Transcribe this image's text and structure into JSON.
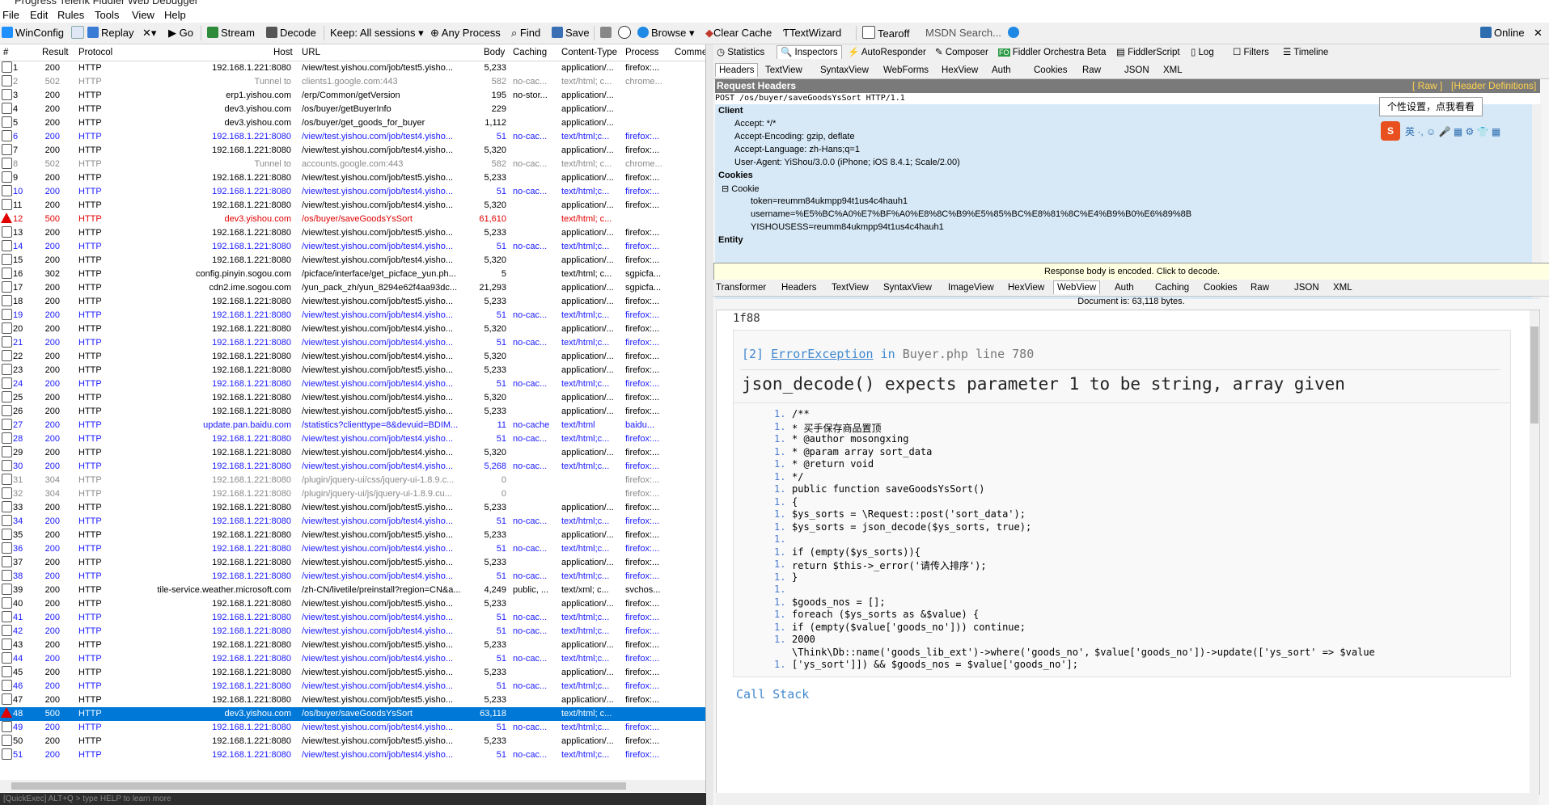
{
  "window": {
    "title": "Progress Telerik Fiddler Web Debugger"
  },
  "menu": [
    "File",
    "Edit",
    "Rules",
    "Tools",
    "View",
    "Help"
  ],
  "toolbar": {
    "winconfig": "WinConfig",
    "replay": "Replay",
    "remove": "✕▾",
    "go": "Go",
    "stream": "Stream",
    "decode": "Decode",
    "keep": "Keep: All sessions ▾",
    "process": "Any Process",
    "find": "Find",
    "save": "Save",
    "browse": "Browse ▾",
    "clear_cache": "Clear Cache",
    "textwizard": "TextWizard",
    "tearoff": "Tearoff",
    "msdn_search": "MSDN Search...",
    "online": "Online"
  },
  "session_headers": {
    "num": "#",
    "result": "Result",
    "protocol": "Protocol",
    "host": "Host",
    "url": "URL",
    "body": "Body",
    "caching": "Caching",
    "ctype": "Content-Type",
    "process": "Process",
    "comments": "Commer"
  },
  "sessions": [
    {
      "num": "1",
      "result": "200",
      "protocol": "HTTP",
      "host": "192.168.1.221:8080",
      "url": "/view/test.yishou.com/job/test5.yisho...",
      "body": "5,233",
      "caching": "",
      "ctype": "application/...",
      "process": "firefox:...",
      "style": ""
    },
    {
      "num": "2",
      "result": "502",
      "protocol": "HTTP",
      "host": "Tunnel to",
      "url": "clients1.google.com:443",
      "body": "582",
      "caching": "no-cac...",
      "ctype": "text/html; c...",
      "process": "chrome...",
      "style": "gray"
    },
    {
      "num": "3",
      "result": "200",
      "protocol": "HTTP",
      "host": "erp1.yishou.com",
      "url": "/erp/Common/getVersion",
      "body": "195",
      "caching": "no-stor...",
      "ctype": "application/...",
      "process": "",
      "style": ""
    },
    {
      "num": "4",
      "result": "200",
      "protocol": "HTTP",
      "host": "dev3.yishou.com",
      "url": "/os/buyer/getBuyerInfo",
      "body": "229",
      "caching": "",
      "ctype": "application/...",
      "process": "",
      "style": ""
    },
    {
      "num": "5",
      "result": "200",
      "protocol": "HTTP",
      "host": "dev3.yishou.com",
      "url": "/os/buyer/get_goods_for_buyer",
      "body": "1,112",
      "caching": "",
      "ctype": "application/...",
      "process": "",
      "style": ""
    },
    {
      "num": "6",
      "result": "200",
      "protocol": "HTTP",
      "host": "192.168.1.221:8080",
      "url": "/view/test.yishou.com/job/test4.yisho...",
      "body": "51",
      "caching": "no-cac...",
      "ctype": "text/html;c...",
      "process": "firefox:...",
      "style": "blue"
    },
    {
      "num": "7",
      "result": "200",
      "protocol": "HTTP",
      "host": "192.168.1.221:8080",
      "url": "/view/test.yishou.com/job/test4.yisho...",
      "body": "5,320",
      "caching": "",
      "ctype": "application/...",
      "process": "firefox:...",
      "style": ""
    },
    {
      "num": "8",
      "result": "502",
      "protocol": "HTTP",
      "host": "Tunnel to",
      "url": "accounts.google.com:443",
      "body": "582",
      "caching": "no-cac...",
      "ctype": "text/html; c...",
      "process": "chrome...",
      "style": "gray"
    },
    {
      "num": "9",
      "result": "200",
      "protocol": "HTTP",
      "host": "192.168.1.221:8080",
      "url": "/view/test.yishou.com/job/test5.yisho...",
      "body": "5,233",
      "caching": "",
      "ctype": "application/...",
      "process": "firefox:...",
      "style": ""
    },
    {
      "num": "10",
      "result": "200",
      "protocol": "HTTP",
      "host": "192.168.1.221:8080",
      "url": "/view/test.yishou.com/job/test4.yisho...",
      "body": "51",
      "caching": "no-cac...",
      "ctype": "text/html;c...",
      "process": "firefox:...",
      "style": "blue"
    },
    {
      "num": "11",
      "result": "200",
      "protocol": "HTTP",
      "host": "192.168.1.221:8080",
      "url": "/view/test.yishou.com/job/test4.yisho...",
      "body": "5,320",
      "caching": "",
      "ctype": "application/...",
      "process": "firefox:...",
      "style": ""
    },
    {
      "num": "12",
      "result": "500",
      "protocol": "HTTP",
      "host": "dev3.yishou.com",
      "url": "/os/buyer/saveGoodsYsSort",
      "body": "61,610",
      "caching": "",
      "ctype": "text/html; c...",
      "process": "",
      "style": "red"
    },
    {
      "num": "13",
      "result": "200",
      "protocol": "HTTP",
      "host": "192.168.1.221:8080",
      "url": "/view/test.yishou.com/job/test5.yisho...",
      "body": "5,233",
      "caching": "",
      "ctype": "application/...",
      "process": "firefox:...",
      "style": ""
    },
    {
      "num": "14",
      "result": "200",
      "protocol": "HTTP",
      "host": "192.168.1.221:8080",
      "url": "/view/test.yishou.com/job/test4.yisho...",
      "body": "51",
      "caching": "no-cac...",
      "ctype": "text/html;c...",
      "process": "firefox:...",
      "style": "blue"
    },
    {
      "num": "15",
      "result": "200",
      "protocol": "HTTP",
      "host": "192.168.1.221:8080",
      "url": "/view/test.yishou.com/job/test4.yisho...",
      "body": "5,320",
      "caching": "",
      "ctype": "application/...",
      "process": "firefox:...",
      "style": ""
    },
    {
      "num": "16",
      "result": "302",
      "protocol": "HTTP",
      "host": "config.pinyin.sogou.com",
      "url": "/picface/interface/get_picface_yun.ph...",
      "body": "5",
      "caching": "",
      "ctype": "text/html; c...",
      "process": "sgpicfa...",
      "style": ""
    },
    {
      "num": "17",
      "result": "200",
      "protocol": "HTTP",
      "host": "cdn2.ime.sogou.com",
      "url": "/yun_pack_zh/yun_8294e62f4aa93dc...",
      "body": "21,293",
      "caching": "",
      "ctype": "application/...",
      "process": "sgpicfa...",
      "style": ""
    },
    {
      "num": "18",
      "result": "200",
      "protocol": "HTTP",
      "host": "192.168.1.221:8080",
      "url": "/view/test.yishou.com/job/test5.yisho...",
      "body": "5,233",
      "caching": "",
      "ctype": "application/...",
      "process": "firefox:...",
      "style": ""
    },
    {
      "num": "19",
      "result": "200",
      "protocol": "HTTP",
      "host": "192.168.1.221:8080",
      "url": "/view/test.yishou.com/job/test4.yisho...",
      "body": "51",
      "caching": "no-cac...",
      "ctype": "text/html;c...",
      "process": "firefox:...",
      "style": "blue"
    },
    {
      "num": "20",
      "result": "200",
      "protocol": "HTTP",
      "host": "192.168.1.221:8080",
      "url": "/view/test.yishou.com/job/test4.yisho...",
      "body": "5,320",
      "caching": "",
      "ctype": "application/...",
      "process": "firefox:...",
      "style": ""
    },
    {
      "num": "21",
      "result": "200",
      "protocol": "HTTP",
      "host": "192.168.1.221:8080",
      "url": "/view/test.yishou.com/job/test4.yisho...",
      "body": "51",
      "caching": "no-cac...",
      "ctype": "text/html;c...",
      "process": "firefox:...",
      "style": "blue"
    },
    {
      "num": "22",
      "result": "200",
      "protocol": "HTTP",
      "host": "192.168.1.221:8080",
      "url": "/view/test.yishou.com/job/test4.yisho...",
      "body": "5,320",
      "caching": "",
      "ctype": "application/...",
      "process": "firefox:...",
      "style": ""
    },
    {
      "num": "23",
      "result": "200",
      "protocol": "HTTP",
      "host": "192.168.1.221:8080",
      "url": "/view/test.yishou.com/job/test5.yisho...",
      "body": "5,233",
      "caching": "",
      "ctype": "application/...",
      "process": "firefox:...",
      "style": ""
    },
    {
      "num": "24",
      "result": "200",
      "protocol": "HTTP",
      "host": "192.168.1.221:8080",
      "url": "/view/test.yishou.com/job/test4.yisho...",
      "body": "51",
      "caching": "no-cac...",
      "ctype": "text/html;c...",
      "process": "firefox:...",
      "style": "blue"
    },
    {
      "num": "25",
      "result": "200",
      "protocol": "HTTP",
      "host": "192.168.1.221:8080",
      "url": "/view/test.yishou.com/job/test4.yisho...",
      "body": "5,320",
      "caching": "",
      "ctype": "application/...",
      "process": "firefox:...",
      "style": ""
    },
    {
      "num": "26",
      "result": "200",
      "protocol": "HTTP",
      "host": "192.168.1.221:8080",
      "url": "/view/test.yishou.com/job/test5.yisho...",
      "body": "5,233",
      "caching": "",
      "ctype": "application/...",
      "process": "firefox:...",
      "style": ""
    },
    {
      "num": "27",
      "result": "200",
      "protocol": "HTTP",
      "host": "update.pan.baidu.com",
      "url": "/statistics?clienttype=8&devuid=BDIM...",
      "body": "11",
      "caching": "no-cache",
      "ctype": "text/html",
      "process": "baidu...",
      "style": "blue"
    },
    {
      "num": "28",
      "result": "200",
      "protocol": "HTTP",
      "host": "192.168.1.221:8080",
      "url": "/view/test.yishou.com/job/test4.yisho...",
      "body": "51",
      "caching": "no-cac...",
      "ctype": "text/html;c...",
      "process": "firefox:...",
      "style": "blue"
    },
    {
      "num": "29",
      "result": "200",
      "protocol": "HTTP",
      "host": "192.168.1.221:8080",
      "url": "/view/test.yishou.com/job/test4.yisho...",
      "body": "5,320",
      "caching": "",
      "ctype": "application/...",
      "process": "firefox:...",
      "style": ""
    },
    {
      "num": "30",
      "result": "200",
      "protocol": "HTTP",
      "host": "192.168.1.221:8080",
      "url": "/view/test.yishou.com/job/test4.yisho...",
      "body": "5,268",
      "caching": "no-cac...",
      "ctype": "text/html;c...",
      "process": "firefox:...",
      "style": "blue"
    },
    {
      "num": "31",
      "result": "304",
      "protocol": "HTTP",
      "host": "192.168.1.221:8080",
      "url": "/plugin/jquery-ui/css/jquery-ui-1.8.9.c...",
      "body": "0",
      "caching": "",
      "ctype": "",
      "process": "firefox:...",
      "style": "gray"
    },
    {
      "num": "32",
      "result": "304",
      "protocol": "HTTP",
      "host": "192.168.1.221:8080",
      "url": "/plugin/jquery-ui/js/jquery-ui-1.8.9.cu...",
      "body": "0",
      "caching": "",
      "ctype": "",
      "process": "firefox:...",
      "style": "gray"
    },
    {
      "num": "33",
      "result": "200",
      "protocol": "HTTP",
      "host": "192.168.1.221:8080",
      "url": "/view/test.yishou.com/job/test5.yisho...",
      "body": "5,233",
      "caching": "",
      "ctype": "application/...",
      "process": "firefox:...",
      "style": ""
    },
    {
      "num": "34",
      "result": "200",
      "protocol": "HTTP",
      "host": "192.168.1.221:8080",
      "url": "/view/test.yishou.com/job/test4.yisho...",
      "body": "51",
      "caching": "no-cac...",
      "ctype": "text/html;c...",
      "process": "firefox:...",
      "style": "blue"
    },
    {
      "num": "35",
      "result": "200",
      "protocol": "HTTP",
      "host": "192.168.1.221:8080",
      "url": "/view/test.yishou.com/job/test5.yisho...",
      "body": "5,233",
      "caching": "",
      "ctype": "application/...",
      "process": "firefox:...",
      "style": ""
    },
    {
      "num": "36",
      "result": "200",
      "protocol": "HTTP",
      "host": "192.168.1.221:8080",
      "url": "/view/test.yishou.com/job/test4.yisho...",
      "body": "51",
      "caching": "no-cac...",
      "ctype": "text/html;c...",
      "process": "firefox:...",
      "style": "blue"
    },
    {
      "num": "37",
      "result": "200",
      "protocol": "HTTP",
      "host": "192.168.1.221:8080",
      "url": "/view/test.yishou.com/job/test5.yisho...",
      "body": "5,233",
      "caching": "",
      "ctype": "application/...",
      "process": "firefox:...",
      "style": ""
    },
    {
      "num": "38",
      "result": "200",
      "protocol": "HTTP",
      "host": "192.168.1.221:8080",
      "url": "/view/test.yishou.com/job/test4.yisho...",
      "body": "51",
      "caching": "no-cac...",
      "ctype": "text/html;c...",
      "process": "firefox:...",
      "style": "blue"
    },
    {
      "num": "39",
      "result": "200",
      "protocol": "HTTP",
      "host": "tile-service.weather.microsoft.com",
      "url": "/zh-CN/livetile/preinstall?region=CN&a...",
      "body": "4,249",
      "caching": "public, ...",
      "ctype": "text/xml; c...",
      "process": "svchos...",
      "style": ""
    },
    {
      "num": "40",
      "result": "200",
      "protocol": "HTTP",
      "host": "192.168.1.221:8080",
      "url": "/view/test.yishou.com/job/test5.yisho...",
      "body": "5,233",
      "caching": "",
      "ctype": "application/...",
      "process": "firefox:...",
      "style": ""
    },
    {
      "num": "41",
      "result": "200",
      "protocol": "HTTP",
      "host": "192.168.1.221:8080",
      "url": "/view/test.yishou.com/job/test4.yisho...",
      "body": "51",
      "caching": "no-cac...",
      "ctype": "text/html;c...",
      "process": "firefox:...",
      "style": "blue"
    },
    {
      "num": "42",
      "result": "200",
      "protocol": "HTTP",
      "host": "192.168.1.221:8080",
      "url": "/view/test.yishou.com/job/test4.yisho...",
      "body": "51",
      "caching": "no-cac...",
      "ctype": "text/html;c...",
      "process": "firefox:...",
      "style": "blue"
    },
    {
      "num": "43",
      "result": "200",
      "protocol": "HTTP",
      "host": "192.168.1.221:8080",
      "url": "/view/test.yishou.com/job/test5.yisho...",
      "body": "5,233",
      "caching": "",
      "ctype": "application/...",
      "process": "firefox:...",
      "style": ""
    },
    {
      "num": "44",
      "result": "200",
      "protocol": "HTTP",
      "host": "192.168.1.221:8080",
      "url": "/view/test.yishou.com/job/test4.yisho...",
      "body": "51",
      "caching": "no-cac...",
      "ctype": "text/html;c...",
      "process": "firefox:...",
      "style": "blue"
    },
    {
      "num": "45",
      "result": "200",
      "protocol": "HTTP",
      "host": "192.168.1.221:8080",
      "url": "/view/test.yishou.com/job/test5.yisho...",
      "body": "5,233",
      "caching": "",
      "ctype": "application/...",
      "process": "firefox:...",
      "style": ""
    },
    {
      "num": "46",
      "result": "200",
      "protocol": "HTTP",
      "host": "192.168.1.221:8080",
      "url": "/view/test.yishou.com/job/test4.yisho...",
      "body": "51",
      "caching": "no-cac...",
      "ctype": "text/html;c...",
      "process": "firefox:...",
      "style": "blue"
    },
    {
      "num": "47",
      "result": "200",
      "protocol": "HTTP",
      "host": "192.168.1.221:8080",
      "url": "/view/test.yishou.com/job/test5.yisho...",
      "body": "5,233",
      "caching": "",
      "ctype": "application/...",
      "process": "firefox:...",
      "style": ""
    },
    {
      "num": "48",
      "result": "500",
      "protocol": "HTTP",
      "host": "dev3.yishou.com",
      "url": "/os/buyer/saveGoodsYsSort",
      "body": "63,118",
      "caching": "",
      "ctype": "text/html; c...",
      "process": "",
      "style": "sel"
    },
    {
      "num": "49",
      "result": "200",
      "protocol": "HTTP",
      "host": "192.168.1.221:8080",
      "url": "/view/test.yishou.com/job/test4.yisho...",
      "body": "51",
      "caching": "no-cac...",
      "ctype": "text/html;c...",
      "process": "firefox:...",
      "style": "blue"
    },
    {
      "num": "50",
      "result": "200",
      "protocol": "HTTP",
      "host": "192.168.1.221:8080",
      "url": "/view/test.yishou.com/job/test5.yisho...",
      "body": "5,233",
      "caching": "",
      "ctype": "application/...",
      "process": "firefox:...",
      "style": ""
    },
    {
      "num": "51",
      "result": "200",
      "protocol": "HTTP",
      "host": "192.168.1.221:8080",
      "url": "/view/test.yishou.com/job/test4.yisho...",
      "body": "51",
      "caching": "no-cac...",
      "ctype": "text/html;c...",
      "process": "firefox:...",
      "style": "blue"
    }
  ],
  "statusbar": "[QuickExec] ALT+Q > type HELP to learn more",
  "top_tabs": [
    "Statistics",
    "Inspectors",
    "AutoResponder",
    "Composer",
    "Fiddler Orchestra Beta",
    "FiddlerScript",
    "Log",
    "Filters",
    "Timeline"
  ],
  "req_tabs": [
    "Headers",
    "TextView",
    "SyntaxView",
    "WebForms",
    "HexView",
    "Auth",
    "Cookies",
    "Raw",
    "JSON",
    "XML"
  ],
  "request": {
    "title": "Request Headers",
    "raw_link": "[ Raw ]",
    "defs_link": "[Header Definitions]",
    "line": "POST /os/buyer/saveGoodsYsSort HTTP/1.1",
    "client": "Client",
    "accept": "Accept: */*",
    "encoding": "Accept-Encoding: gzip, deflate",
    "language": "Accept-Language: zh-Hans;q=1",
    "ua": "User-Agent: YiShou/3.0.0 (iPhone; iOS 8.4.1; Scale/2.00)",
    "cookies_sec": "Cookies",
    "cookie": "Cookie",
    "token": "token=reumm84ukmpp94t1us4c4hauh1",
    "username": "username=%E5%BC%A0%E7%BF%A0%E8%8C%B9%E5%85%BC%E8%81%8C%E4%B9%B0%E6%89%8B",
    "yishou": "YISHOUSESS=reumm84ukmpp94t1us4c4hauh1",
    "entity": "Entity",
    "tooltip": "个性设置，点我看看"
  },
  "encoded_bar": "Response body is encoded. Click to decode.",
  "resp_tabs": [
    "Transformer",
    "Headers",
    "TextView",
    "SyntaxView",
    "ImageView",
    "HexView",
    "WebView",
    "Auth",
    "Caching",
    "Cookies",
    "Raw",
    "JSON",
    "XML"
  ],
  "doc_size": "Document is: 63,118 bytes.",
  "webview": {
    "chunk": "1f88",
    "err_num": "[2]",
    "err_class": "ErrorException",
    "err_in": "in",
    "err_file": "Buyer.php line 780",
    "err_msg": "json_decode() expects parameter 1 to be string, array given",
    "code": [
      "/**",
      "* 买手保存商品置顶",
      "* @author mosongxing",
      "* @param array sort_data",
      "* @return void",
      "*/",
      "public function saveGoodsYsSort()",
      "{",
      "$ys_sorts = \\Request::post('sort_data');",
      "$ys_sorts = json_decode($ys_sorts, true);",
      "",
      "if (empty($ys_sorts)){",
      "return $this->_error('请传入排序');",
      "}",
      "",
      "$goods_nos = [];",
      "foreach ($ys_sorts as &$value) {",
      "if (empty($value['goods_no'])) continue;",
      "$value['goods_no'])->update(['ys_sort' => $value"
    ],
    "code_num": "1.",
    "wrap1": "2000",
    "wrap2": "\\Think\\Db::name('goods_lib_ext')->where('goods_no',",
    "last": "['ys_sort']]) && $goods_nos = $value['goods_no'];",
    "call_stack": "Call Stack"
  }
}
